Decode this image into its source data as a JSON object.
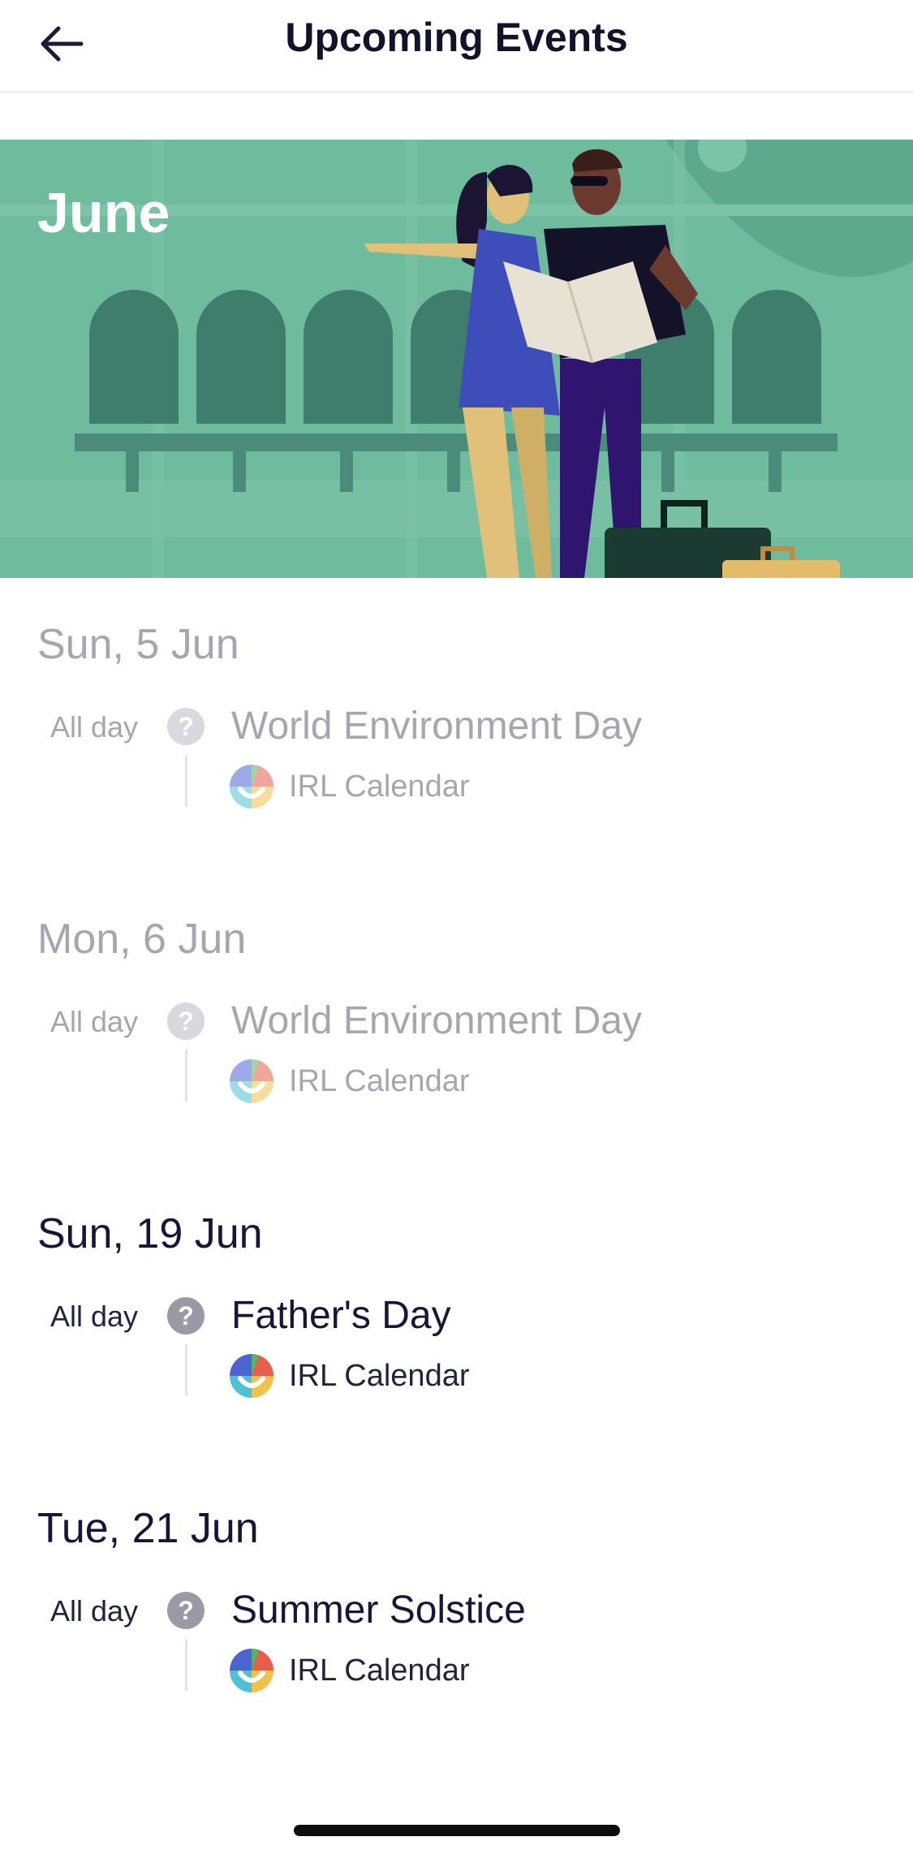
{
  "header": {
    "title": "Upcoming Events",
    "back_icon": "arrow-left-icon"
  },
  "hero": {
    "month": "June",
    "colors": {
      "background": "#6fbb9e",
      "accent": "#4f9c82"
    }
  },
  "days": [
    {
      "date": "Sun, 5 Jun",
      "state": "past",
      "event": {
        "time": "All day",
        "status_icon": "question-icon",
        "name": "World Environment Day",
        "calendar_icon": "irl-calendar-icon",
        "calendar": "IRL Calendar"
      }
    },
    {
      "date": "Mon, 6 Jun",
      "state": "past",
      "event": {
        "time": "All day",
        "status_icon": "question-icon",
        "name": "World Environment Day",
        "calendar_icon": "irl-calendar-icon",
        "calendar": "IRL Calendar"
      }
    },
    {
      "date": "Sun, 19 Jun",
      "state": "upcoming",
      "event": {
        "time": "All day",
        "status_icon": "question-icon",
        "name": "Father's Day",
        "calendar_icon": "irl-calendar-icon",
        "calendar": "IRL Calendar"
      }
    },
    {
      "date": "Tue, 21 Jun",
      "state": "upcoming",
      "event": {
        "time": "All day",
        "status_icon": "question-icon",
        "name": "Summer Solstice",
        "calendar_icon": "irl-calendar-icon",
        "calendar": "IRL Calendar"
      }
    }
  ],
  "colors": {
    "text_primary": "#16153a",
    "text_past": "#a7a6b0"
  }
}
